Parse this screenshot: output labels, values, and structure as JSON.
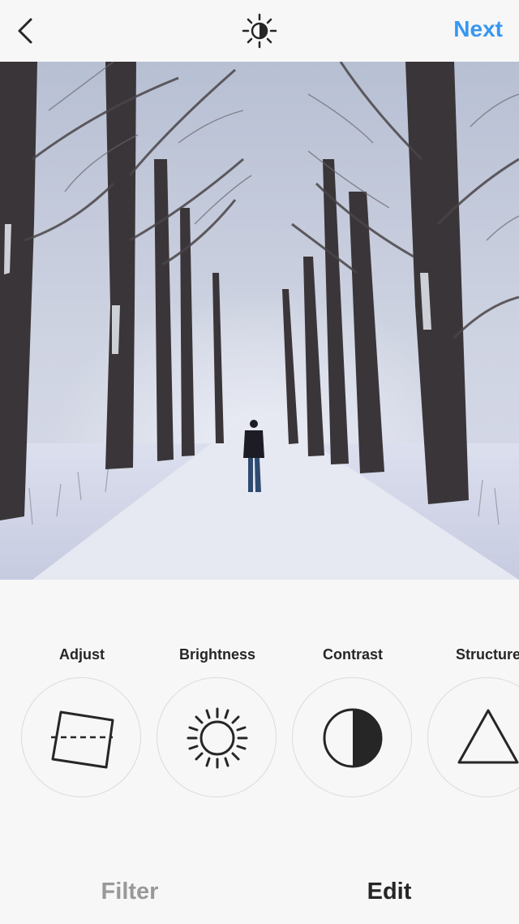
{
  "header": {
    "back_icon": "chevron-left-icon",
    "lux_icon": "lux-sun-icon",
    "next_label": "Next"
  },
  "photo": {
    "description_icon": "snowy-tree-lined-road-photo"
  },
  "tools": [
    {
      "label": "Adjust",
      "icon": "adjust-icon"
    },
    {
      "label": "Brightness",
      "icon": "brightness-icon"
    },
    {
      "label": "Contrast",
      "icon": "contrast-icon"
    },
    {
      "label": "Structure",
      "icon": "structure-icon"
    }
  ],
  "tabs": {
    "filter_label": "Filter",
    "edit_label": "Edit",
    "active": "Edit"
  },
  "colors": {
    "accent": "#3897f0",
    "active_tab": "#262626",
    "inactive_tab": "#999999"
  }
}
